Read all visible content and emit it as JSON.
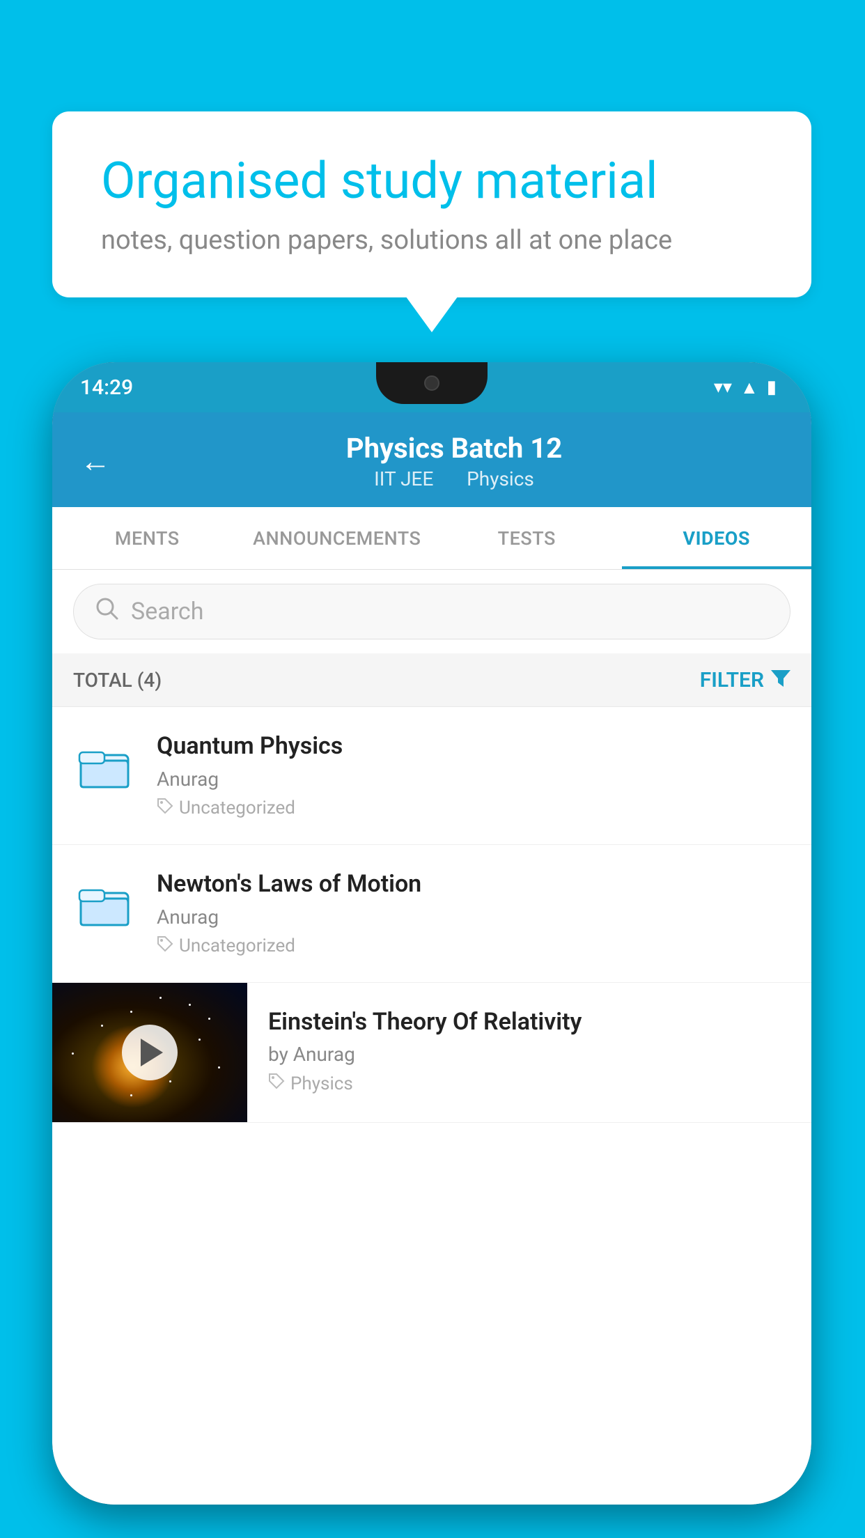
{
  "background_color": "#00BFEA",
  "bubble": {
    "title": "Organised study material",
    "subtitle": "notes, question papers, solutions all at one place"
  },
  "phone": {
    "status_bar": {
      "time": "14:29",
      "wifi_icon": "▼",
      "signal_icon": "▲",
      "battery_icon": "▮"
    },
    "header": {
      "back_label": "←",
      "title": "Physics Batch 12",
      "tag1": "IIT JEE",
      "tag2": "Physics"
    },
    "tabs": [
      {
        "label": "MENTS",
        "active": false
      },
      {
        "label": "ANNOUNCEMENTS",
        "active": false
      },
      {
        "label": "TESTS",
        "active": false
      },
      {
        "label": "VIDEOS",
        "active": true
      }
    ],
    "search": {
      "placeholder": "Search"
    },
    "filter_row": {
      "total_label": "TOTAL (4)",
      "filter_label": "FILTER"
    },
    "items": [
      {
        "id": 1,
        "title": "Quantum Physics",
        "author": "Anurag",
        "tag": "Uncategorized",
        "has_thumb": false
      },
      {
        "id": 2,
        "title": "Newton's Laws of Motion",
        "author": "Anurag",
        "tag": "Uncategorized",
        "has_thumb": false
      },
      {
        "id": 3,
        "title": "Einstein's Theory Of Relativity",
        "author": "by Anurag",
        "tag": "Physics",
        "has_thumb": true
      }
    ]
  }
}
